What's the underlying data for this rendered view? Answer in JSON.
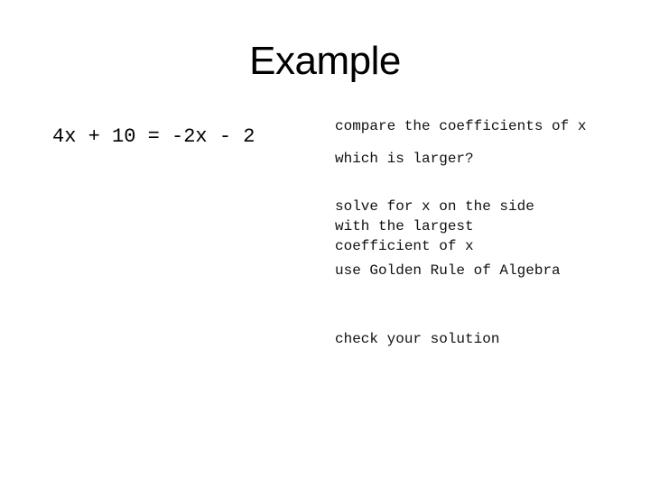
{
  "slide": {
    "title": "Example",
    "equation": "4x + 10 = -2x - 2",
    "steps": [
      "compare the coefficients of x",
      "which is larger?",
      "solve for x on the side\nwith the largest\ncoefficient of x",
      "use Golden Rule of Algebra",
      "check your solution"
    ]
  }
}
